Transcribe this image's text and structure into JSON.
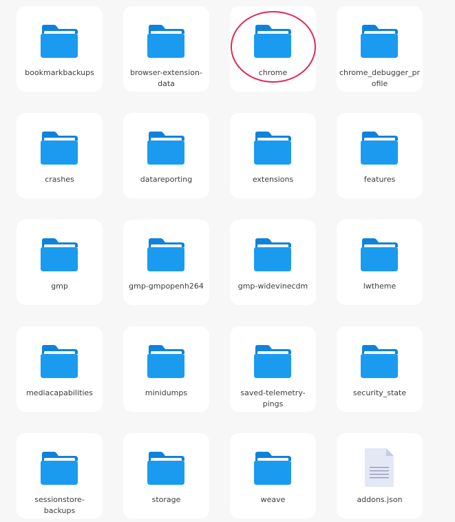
{
  "items": [
    {
      "label": "bookmarkbackups",
      "icon": "folder-icon",
      "type": "folder"
    },
    {
      "label": "browser-extension-data",
      "icon": "folder-icon",
      "type": "folder"
    },
    {
      "label": "chrome",
      "icon": "folder-icon",
      "type": "folder"
    },
    {
      "label": "chrome_debugger_profile",
      "icon": "folder-icon",
      "type": "folder"
    },
    {
      "label": "crashes",
      "icon": "folder-icon",
      "type": "folder"
    },
    {
      "label": "datareporting",
      "icon": "folder-icon",
      "type": "folder"
    },
    {
      "label": "extensions",
      "icon": "folder-icon",
      "type": "folder"
    },
    {
      "label": "features",
      "icon": "folder-icon",
      "type": "folder"
    },
    {
      "label": "gmp",
      "icon": "folder-icon",
      "type": "folder"
    },
    {
      "label": "gmp-gmpopenh264",
      "icon": "folder-icon",
      "type": "folder"
    },
    {
      "label": "gmp-widevinecdm",
      "icon": "folder-icon",
      "type": "folder"
    },
    {
      "label": "lwtheme",
      "icon": "folder-icon",
      "type": "folder"
    },
    {
      "label": "mediacapabilities",
      "icon": "folder-icon",
      "type": "folder"
    },
    {
      "label": "minidumps",
      "icon": "folder-icon",
      "type": "folder"
    },
    {
      "label": "saved-telemetry-pings",
      "icon": "folder-icon",
      "type": "folder"
    },
    {
      "label": "security_state",
      "icon": "folder-icon",
      "type": "folder"
    },
    {
      "label": "sessionstore-backups",
      "icon": "folder-icon",
      "type": "folder"
    },
    {
      "label": "storage",
      "icon": "folder-icon",
      "type": "folder"
    },
    {
      "label": "weave",
      "icon": "folder-icon",
      "type": "folder"
    },
    {
      "label": "addons.json",
      "icon": "text-file-icon",
      "type": "file"
    }
  ],
  "highlighted_item": "chrome",
  "colors": {
    "folder": "#1a9bf0",
    "folder_dark": "#0f82dc",
    "highlight": "#e0254f",
    "tile_bg": "#ffffff",
    "page_bg": "#f7f7f7",
    "label": "#3c3c3c"
  }
}
